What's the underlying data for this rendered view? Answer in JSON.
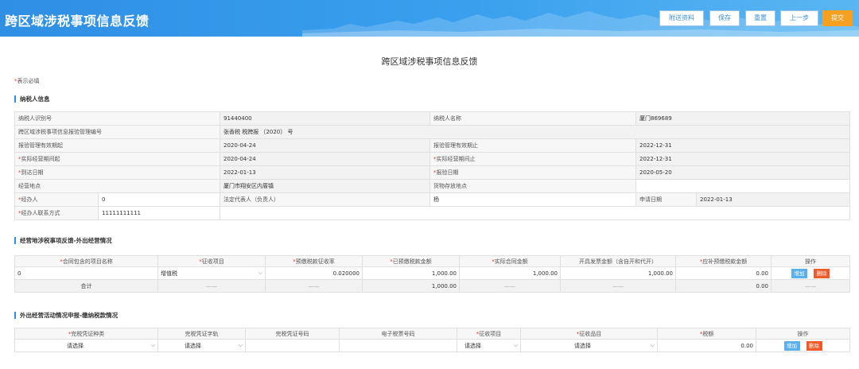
{
  "header": {
    "title": "跨区域涉税事项信息反馈",
    "buttons": {
      "attach": "附送资料",
      "save": "保存",
      "reset": "重置",
      "prev": "上一步",
      "submit": "提交"
    },
    "accent": "#2f8fe3",
    "submit_color": "#f5a020"
  },
  "page_title": "跨区域涉税事项信息反馈",
  "required_note": {
    "star": "*",
    "text": "表示必填"
  },
  "taxpayer": {
    "section_title": "纳税人信息",
    "rows": [
      {
        "l1": "纳税人识别号",
        "v1": "91440400",
        "l2": "纳税人名称",
        "v2": "厦门869689"
      },
      {
        "l1": "跨区域涉税事项信息报验管理编号",
        "v1": "张香税 税跨报 〔2020〕        号"
      },
      {
        "l1": "报验管理有效期起",
        "v1": "2020-04-24",
        "l2": "报验管理有效期止",
        "v2": "2022-12-31"
      },
      {
        "l1": "实际经营期间起",
        "v1": "2020-04-24",
        "l2": "实际经营期间止",
        "v2": "2022-12-31"
      },
      {
        "l1": "到达日期",
        "v1": "2022-01-13",
        "l2": "报验日期",
        "v2": "2020-05-20"
      },
      {
        "l1": "经营地点",
        "v1": "厦门市翔安区内厝镇",
        "l2": "货物存放地点",
        "v2": ""
      }
    ],
    "agent_label": "经办人",
    "agent_value": "0",
    "legal_rep_label": "法定代表人（负责人）",
    "legal_rep_value": "杨",
    "apply_date_label": "申请日期",
    "apply_date_value": "2022-01-13",
    "agent_phone_label": "经办人联系方式",
    "agent_phone_value": "11111111111"
  },
  "operation": {
    "section_title": "经营地涉税事项反馈-外出经营情况",
    "headers": [
      "合同包含的项目名称",
      "征收项目",
      "预缴税款征收率",
      "已预缴税款金额",
      "实际合同金额",
      "开具发票金额（含自开和代开）",
      "应补预缴税款金额",
      "操作"
    ],
    "required": [
      true,
      true,
      true,
      true,
      true,
      false,
      true,
      false
    ],
    "row": {
      "name": "0",
      "levy_item": "增值税",
      "rate": "0.020000",
      "prepaid": "1,000.00",
      "contract": "1,000.00",
      "invoice": "1,000.00",
      "due": "0.00"
    },
    "total": {
      "label": "合计",
      "dash": "——",
      "prepaid": "1,000.00",
      "due": "0.00"
    },
    "add_label": "增加",
    "del_label": "删除"
  },
  "payment": {
    "section_title": "外出经营活动情况申报-缴纳税款情况",
    "headers": [
      "完税凭证种类",
      "完税凭证字轨",
      "完税凭证号码",
      "电子税票号码",
      "征收项目",
      "征收品目",
      "税额",
      "操作"
    ],
    "required": [
      true,
      false,
      false,
      false,
      true,
      true,
      true,
      false
    ],
    "row": {
      "voucher_type": "请选择",
      "voucher_track": "请选择",
      "levy_item": "请选择",
      "levy_sub": "请选择",
      "tax": "0.00"
    },
    "add_label": "增加",
    "del_label": "删除"
  }
}
